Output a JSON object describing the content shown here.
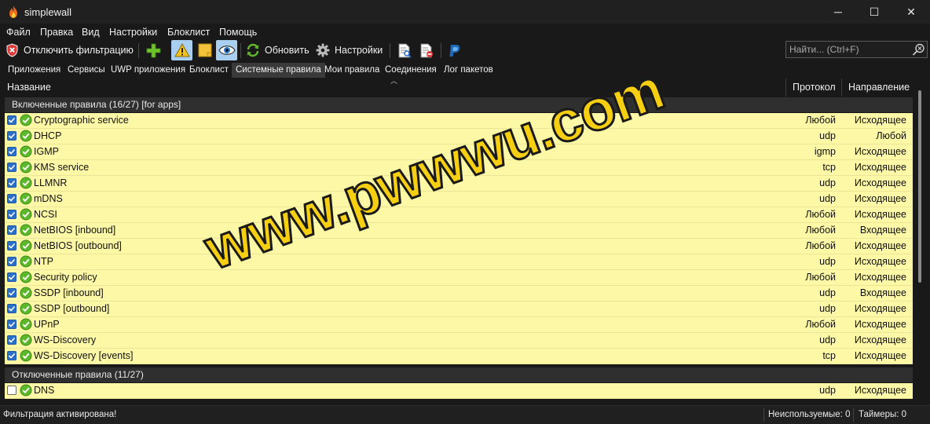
{
  "window": {
    "title": "simplewall",
    "minimize_glyph": "─",
    "maximize_glyph": "☐",
    "close_glyph": "✕"
  },
  "menu": [
    "Файл",
    "Правка",
    "Вид",
    "Настройки",
    "Блоклист",
    "Помощь"
  ],
  "toolbar": {
    "disable_filter_label": "Отключить фильтрацию",
    "refresh_label": "Обновить",
    "settings_label": "Настройки",
    "icons": [
      "shield-icon",
      "add-icon",
      "warning-icon",
      "note-icon",
      "eye-icon",
      "refresh-icon",
      "gear-icon",
      "log-icon",
      "log-clear-icon",
      "paypal-icon"
    ]
  },
  "search": {
    "placeholder": "Найти... (Ctrl+F)"
  },
  "tabs": [
    {
      "label": "Приложения",
      "active": false
    },
    {
      "label": "Сервисы",
      "active": false
    },
    {
      "label": "UWP приложения",
      "active": false
    },
    {
      "label": "Блоклист",
      "active": false
    },
    {
      "label": "Системные правила",
      "active": true
    },
    {
      "label": "Мои правила",
      "active": false
    },
    {
      "label": "Соединения",
      "active": false
    },
    {
      "label": "Лог пакетов",
      "active": false
    }
  ],
  "columns": {
    "name": "Название",
    "protocol": "Протокол",
    "direction": "Направление"
  },
  "groups": [
    {
      "title": "Включенные правила (16/27) [for apps]",
      "checked": true,
      "rows": [
        {
          "name": "Cryptographic service",
          "protocol": "Любой",
          "direction": "Исходящее"
        },
        {
          "name": "DHCP",
          "protocol": "udp",
          "direction": "Любой"
        },
        {
          "name": "IGMP",
          "protocol": "igmp",
          "direction": "Исходящее"
        },
        {
          "name": "KMS service",
          "protocol": "tcp",
          "direction": "Исходящее"
        },
        {
          "name": "LLMNR",
          "protocol": "udp",
          "direction": "Исходящее"
        },
        {
          "name": "mDNS",
          "protocol": "udp",
          "direction": "Исходящее"
        },
        {
          "name": "NCSI",
          "protocol": "Любой",
          "direction": "Исходящее"
        },
        {
          "name": "NetBIOS [inbound]",
          "protocol": "Любой",
          "direction": "Входящее"
        },
        {
          "name": "NetBIOS [outbound]",
          "protocol": "Любой",
          "direction": "Исходящее"
        },
        {
          "name": "NTP",
          "protocol": "udp",
          "direction": "Исходящее"
        },
        {
          "name": "Security policy",
          "protocol": "Любой",
          "direction": "Исходящее"
        },
        {
          "name": "SSDP [inbound]",
          "protocol": "udp",
          "direction": "Входящее"
        },
        {
          "name": "SSDP [outbound]",
          "protocol": "udp",
          "direction": "Исходящее"
        },
        {
          "name": "UPnP",
          "protocol": "Любой",
          "direction": "Исходящее"
        },
        {
          "name": "WS-Discovery",
          "protocol": "udp",
          "direction": "Исходящее"
        },
        {
          "name": "WS-Discovery [events]",
          "protocol": "tcp",
          "direction": "Исходящее"
        }
      ]
    },
    {
      "title": "Отключенные правила (11/27)",
      "checked": false,
      "rows": [
        {
          "name": "DNS",
          "protocol": "udp",
          "direction": "Исходящее"
        }
      ]
    }
  ],
  "watermark": "www.pwwwu.com",
  "status": {
    "filter_state": "Фильтрация активирована!",
    "unused": "Неиспользуемые: 0",
    "timers": "Таймеры: 0"
  },
  "colors": {
    "row_bg": "#fdf8a6",
    "active_toggle": "#a9cff0",
    "watermark": "#f6cf13"
  }
}
